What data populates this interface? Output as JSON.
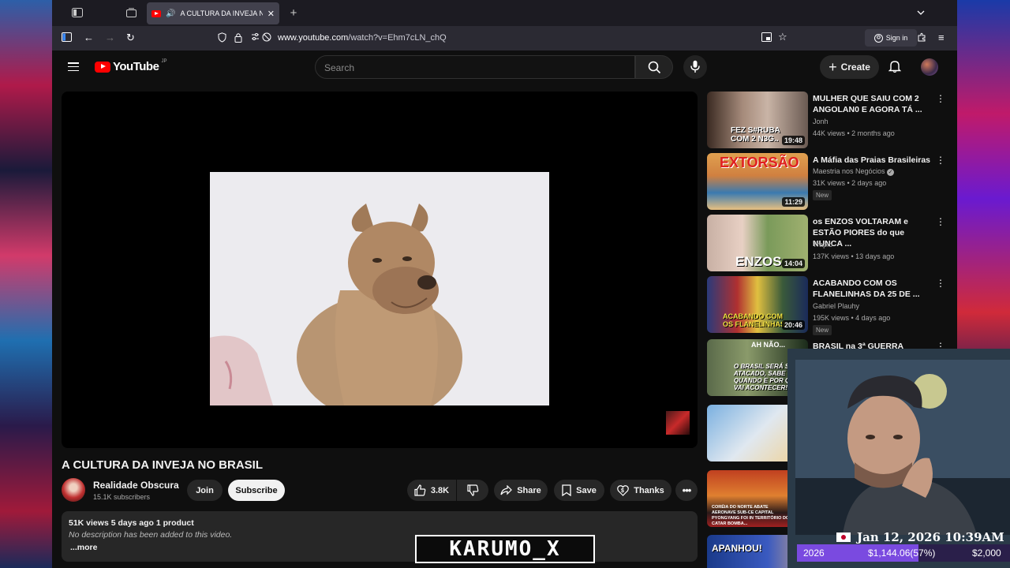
{
  "browser": {
    "tab_title": "A CULTURA DA INVEJA NO",
    "url_host": "www.youtube.com",
    "url_path": "/watch?v=Ehm7cLN_chQ",
    "signin_label": "Sign in"
  },
  "yt": {
    "logo_text": "YouTube",
    "logo_country": "JP",
    "search_placeholder": "Search",
    "create_label": "Create"
  },
  "video": {
    "title": "A CULTURA DA INVEJA NO BRASIL",
    "channel": "Realidade Obscura",
    "subscribers": "15.1K subscribers",
    "join_label": "Join",
    "subscribe_label": "Subscribe",
    "likes": "3.8K",
    "share_label": "Share",
    "save_label": "Save",
    "thanks_label": "Thanks",
    "desc_meta": "51K views  5 days ago  1 product",
    "desc_text": "No description has been added to this video.",
    "desc_more": "...more"
  },
  "recommendations": [
    {
      "title": "MULHER QUE SAIU COM 2 ANGOLAN0 E AGORA TÁ ...",
      "channel": "Jonh",
      "stats": "44K views • 2 months ago",
      "duration": "19:48",
      "thumb_text": "FEZ S#RUBA COM 2 N3G..",
      "badge": ""
    },
    {
      "title": "A Máfia das Praias Brasileiras",
      "channel": "Maestria nos Negócios",
      "stats": "31K views • 2 days ago",
      "duration": "11:29",
      "thumb_text": "EXTORSÃO",
      "badge": "New"
    },
    {
      "title": "os ENZOS VOLTARAM e ESTÃO PIORES do que NUNCA ...",
      "channel": "Trapio",
      "stats": "137K views • 13 days ago",
      "duration": "14:04",
      "thumb_text": "ENZOS",
      "badge": ""
    },
    {
      "title": "ACABANDO COM OS FLANELINHAS DA 25 DE ...",
      "channel": "Gabriel Plauhy",
      "stats": "195K views • 4 days ago",
      "duration": "20:46",
      "thumb_text": "ACABANDO COM OS FLANELINHAS",
      "badge": "New"
    },
    {
      "title": "BRASIL na 3ª GUERRA",
      "channel": "",
      "stats": "",
      "duration": "",
      "thumb_text": "O BRASIL SERÁ SIM ATACADO, SABE QUANDO E POR QUÊ? VAI ACONTECER!",
      "badge": ""
    }
  ],
  "overlay": {
    "datetime": "Jan 12, 2026 10:39AM",
    "goal_year": "2026",
    "goal_amount": "$1,144.06(57%)",
    "goal_target": "$2,000",
    "goal_fraction": 0.57,
    "watermark": "KARUMO_X",
    "thumb_news": "CORÉIA DO NORTE ABATE AERONAVE SUB-CE CAPITAL PYONGYANG FOI IN TERRITÓRIO DO CATAR BOMBA...",
    "thumb_apanhou": "APANHOU!",
    "thumb_ahnao": "AH NÃO..."
  },
  "colors": {
    "yt_red": "#ff0000",
    "bg": "#0f0f0f",
    "goal_purple": "#7a4ae0"
  }
}
